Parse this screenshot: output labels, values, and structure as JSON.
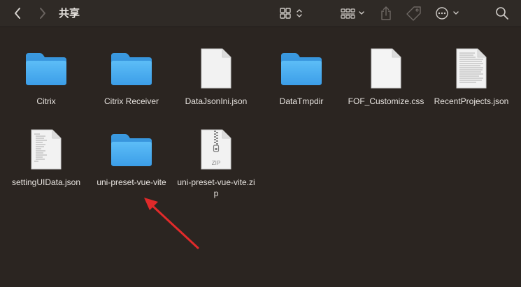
{
  "window": {
    "title": "共享"
  },
  "toolbar": {
    "back_label": "Back",
    "forward_label": "Forward",
    "view_label": "View",
    "group_label": "Group",
    "share_label": "Share",
    "tags_label": "Tags",
    "action_label": "Action",
    "search_label": "Search"
  },
  "items": [
    {
      "name": "Citrix",
      "type": "folder"
    },
    {
      "name": "Citrix Receiver",
      "type": "folder"
    },
    {
      "name": "DataJsonIni.json",
      "type": "document"
    },
    {
      "name": "DataTmpdir",
      "type": "folder"
    },
    {
      "name": "FOF_Customize.css",
      "type": "document"
    },
    {
      "name": "RecentProjects.json",
      "type": "text-document"
    },
    {
      "name": "settingUIData.json",
      "type": "text-document"
    },
    {
      "name": "uni-preset-vue-vite",
      "type": "folder"
    },
    {
      "name": "uni-preset-vue-vite.zip",
      "type": "zip",
      "badge": "ZIP"
    }
  ],
  "colors": {
    "background": "#2b2521",
    "toolbar": "#2f2a26",
    "folder": "#3aa0ea",
    "arrow": "#e02a2a"
  }
}
